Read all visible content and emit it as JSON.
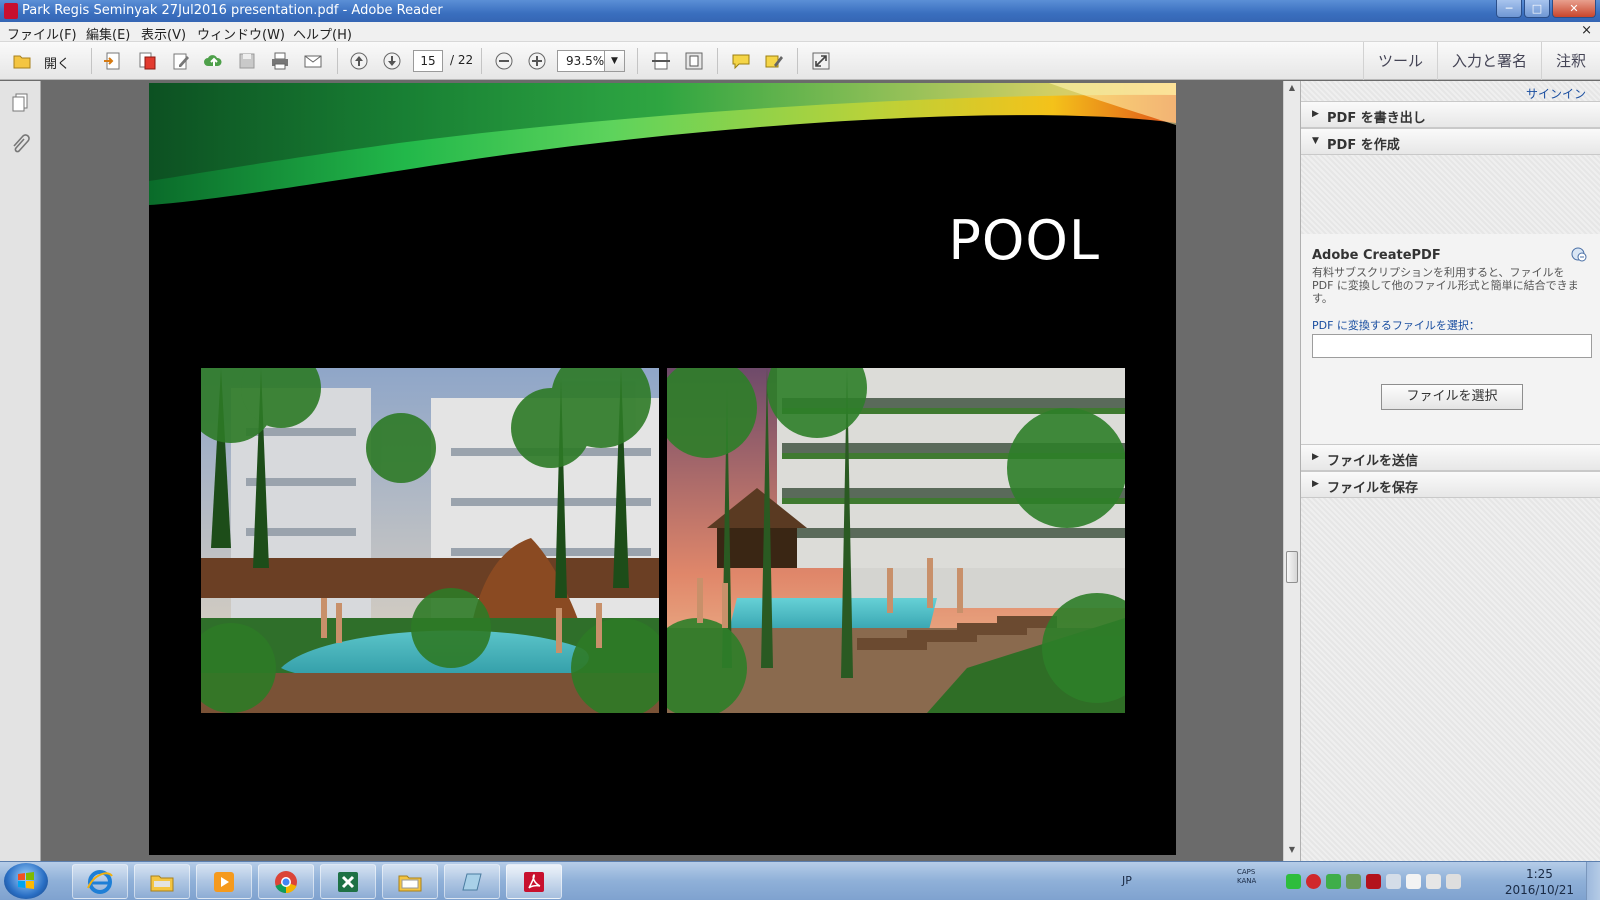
{
  "window": {
    "title": "Park Regis Seminyak 27Jul2016 presentation.pdf - Adobe Reader",
    "minimize": "─",
    "maximize": "□",
    "close": "✕"
  },
  "menu": {
    "items": [
      "ファイル(F)",
      "編集(E)",
      "表示(V)",
      "ウィンドウ(W)",
      "ヘルプ(H)"
    ],
    "close": "×"
  },
  "toolbar": {
    "open_label": "開く",
    "page_current": "15",
    "page_total": "/ 22",
    "zoom": "93.5%",
    "right_tabs": [
      "ツール",
      "入力と署名",
      "注釈"
    ]
  },
  "document": {
    "heading": "POOL"
  },
  "right_panel": {
    "signin": "サインイン",
    "sections": {
      "export": "PDF を書き出し",
      "create": "PDF を作成",
      "send": "ファイルを送信",
      "save": "ファイルを保存"
    },
    "create_pdf": {
      "title": "Adobe CreatePDF",
      "description": "有料サブスクリプションを利用すると、ファイルを PDF に変換して他のファイル形式と簡単に結合できます。",
      "select_label": "PDF に変換するファイルを選択：",
      "button": "ファイルを選択"
    }
  },
  "taskbar": {
    "language": "JP",
    "caps": "CAPS",
    "kana": "KANA",
    "time": "1:25",
    "date": "2016/10/21"
  },
  "colors": {
    "titlebar": "#3a6fbf",
    "link_blue": "#1a4ea0",
    "acrobat_red": "#c8102e"
  }
}
